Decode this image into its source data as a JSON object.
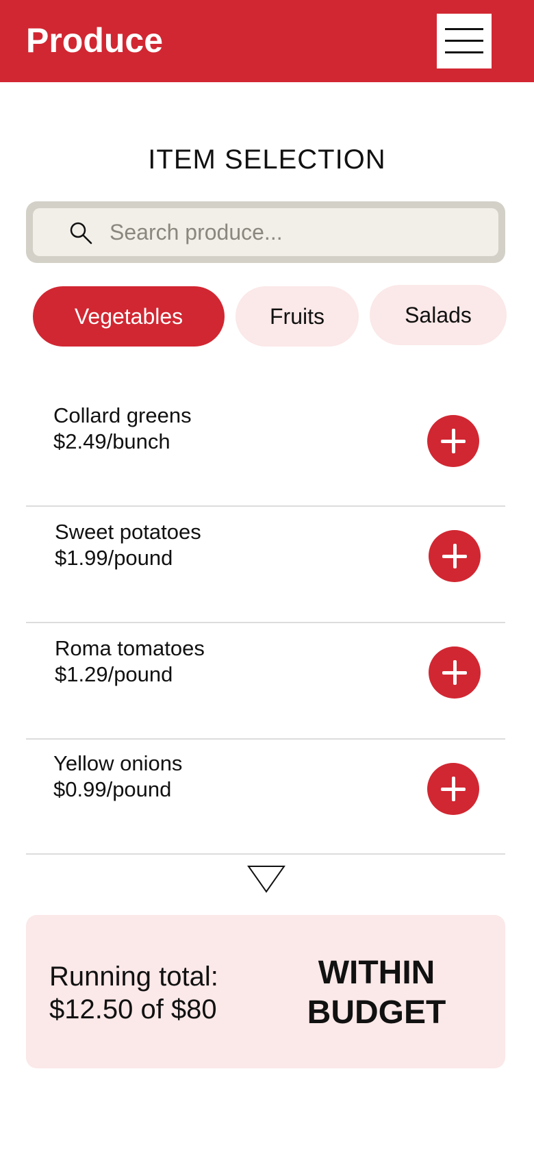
{
  "header": {
    "title": "Produce",
    "menu_icon": "hamburger-menu-icon",
    "accent_color": "#d12732"
  },
  "section_title": "ITEM SELECTION",
  "search": {
    "placeholder": "Search produce...",
    "value": "",
    "icon": "search-icon"
  },
  "categories": [
    {
      "label": "Vegetables",
      "selected": true
    },
    {
      "label": "Fruits",
      "selected": false
    },
    {
      "label": "Salads",
      "selected": false
    }
  ],
  "items": [
    {
      "name": "Collard greens",
      "price": "$2.49/bunch"
    },
    {
      "name": "Sweet potatoes",
      "price": "$1.99/pound"
    },
    {
      "name": "Roma tomatoes",
      "price": "$1.29/pound"
    },
    {
      "name": "Yellow onions",
      "price": "$0.99/pound"
    }
  ],
  "more_indicator": "chevron-down-outline-icon",
  "summary": {
    "total_label": "Running total:",
    "total_value": "$12.50 of $80",
    "status_line1": "WITHIN",
    "status_line2": "BUDGET"
  }
}
